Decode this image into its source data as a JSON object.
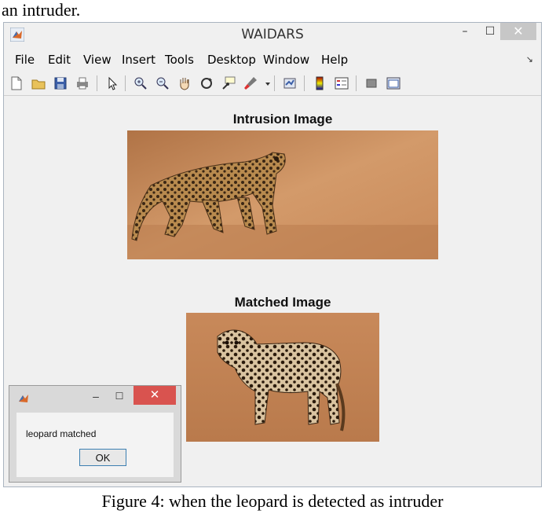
{
  "page": {
    "top_text": "an intruder.",
    "caption": "Figure 4: when the leopard is detected as intruder"
  },
  "window": {
    "title": "WAIDARS",
    "controls": {
      "minimize": "–",
      "maximize": "☐",
      "close": "✕"
    }
  },
  "menu": {
    "items": [
      "File",
      "Edit",
      "View",
      "Insert",
      "Tools",
      "Desktop",
      "Window",
      "Help"
    ]
  },
  "toolbar": {
    "icons": [
      "new-file-icon",
      "open-folder-icon",
      "save-icon",
      "print-icon",
      "pointer-icon",
      "zoom-in-icon",
      "zoom-out-icon",
      "pan-hand-icon",
      "rotate-3d-icon",
      "data-cursor-icon",
      "brush-icon",
      "brush-dropdown-icon",
      "link-plot-icon",
      "colorbar-icon",
      "legend-icon",
      "hide-plot-tools-icon",
      "show-plot-tools-icon"
    ]
  },
  "figure": {
    "intrusion_title": "Intrusion Image",
    "matched_title": "Matched Image"
  },
  "dialog": {
    "message": "leopard matched",
    "ok_label": "OK",
    "controls": {
      "minimize": "–",
      "maximize": "☐",
      "close": "✕"
    }
  },
  "colors": {
    "window_bg": "#f0f0f0",
    "close_button": "#d9534f",
    "ground": "#c98a5a",
    "leopard_coat": "#b88a4e"
  }
}
